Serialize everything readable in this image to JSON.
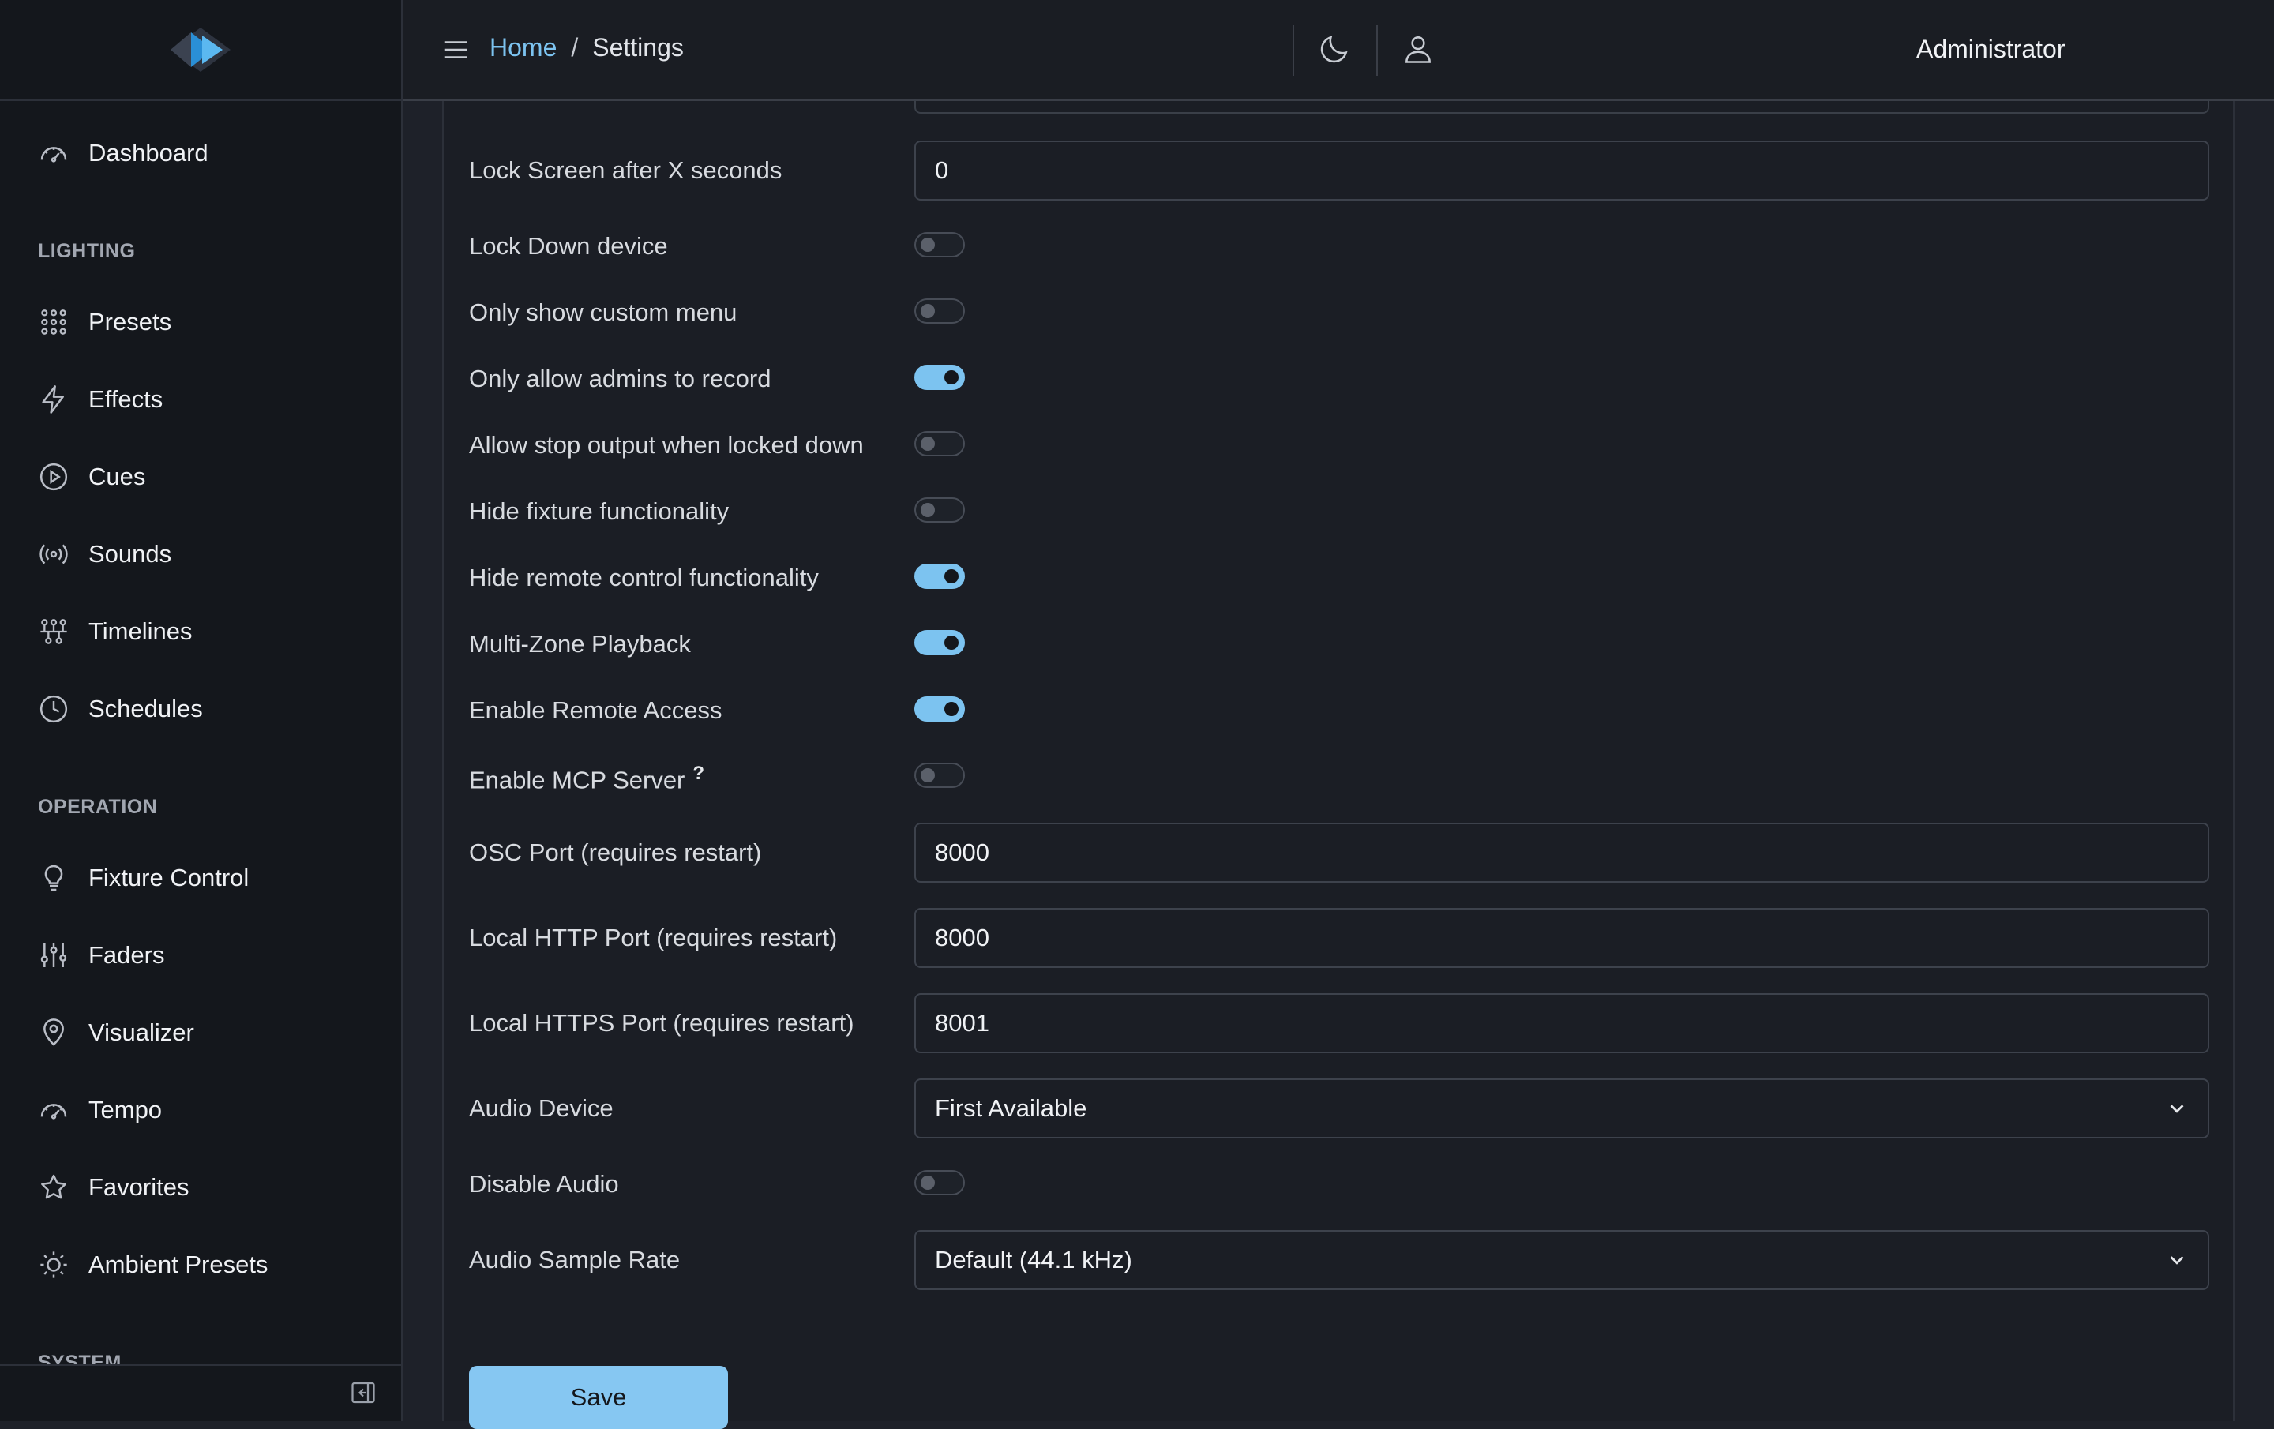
{
  "header": {
    "breadcrumb_home": "Home",
    "breadcrumb_separator": "/",
    "breadcrumb_current": "Settings",
    "user_label": "Administrator",
    "icons": [
      "hamburger-menu-icon",
      "moon-icon",
      "user-icon"
    ]
  },
  "sidebar": {
    "items": [
      {
        "label": "Dashboard",
        "icon": "gauge-icon"
      },
      {
        "label": "Presets",
        "icon": "grid-dots-icon"
      },
      {
        "label": "Effects",
        "icon": "lightning-icon"
      },
      {
        "label": "Cues",
        "icon": "play-circle-icon"
      },
      {
        "label": "Sounds",
        "icon": "broadcast-icon"
      },
      {
        "label": "Timelines",
        "icon": "timeline-icon"
      },
      {
        "label": "Schedules",
        "icon": "clock-icon"
      },
      {
        "label": "Fixture Control",
        "icon": "lightbulb-icon"
      },
      {
        "label": "Faders",
        "icon": "sliders-icon"
      },
      {
        "label": "Visualizer",
        "icon": "map-pin-icon"
      },
      {
        "label": "Tempo",
        "icon": "gauge-icon"
      },
      {
        "label": "Favorites",
        "icon": "star-icon"
      },
      {
        "label": "Ambient Presets",
        "icon": "sun-icon"
      }
    ],
    "sections": {
      "lighting": "LIGHTING",
      "operation": "OPERATION",
      "system": "SYSTEM"
    }
  },
  "settings": {
    "lock_screen": {
      "label": "Lock Screen after X seconds",
      "value": "0"
    },
    "toggles": [
      {
        "label": "Lock Down device",
        "on": false
      },
      {
        "label": "Only show custom menu",
        "on": false
      },
      {
        "label": "Only allow admins to record",
        "on": true
      },
      {
        "label": "Allow stop output when locked down",
        "on": false
      },
      {
        "label": "Hide fixture functionality",
        "on": false
      },
      {
        "label": "Hide remote control functionality",
        "on": true
      },
      {
        "label": "Multi-Zone Playback",
        "on": true
      },
      {
        "label": "Enable Remote Access",
        "on": true
      },
      {
        "label": "Enable MCP Server",
        "on": false,
        "help": "?"
      }
    ],
    "osc_port": {
      "label": "OSC Port (requires restart)",
      "value": "8000"
    },
    "http_port": {
      "label": "Local HTTP Port (requires restart)",
      "value": "8000"
    },
    "https_port": {
      "label": "Local HTTPS Port (requires restart)",
      "value": "8001"
    },
    "audio_device": {
      "label": "Audio Device",
      "value": "First Available"
    },
    "disable_audio": {
      "label": "Disable Audio",
      "on": false
    },
    "sample_rate": {
      "label": "Audio Sample Rate",
      "value": "Default (44.1 kHz)"
    }
  },
  "actions": {
    "save_label": "Save"
  },
  "colors": {
    "accent": "#7cc3f0",
    "sidebar_bg": "#14171c",
    "content_bg": "#1b1e25"
  }
}
